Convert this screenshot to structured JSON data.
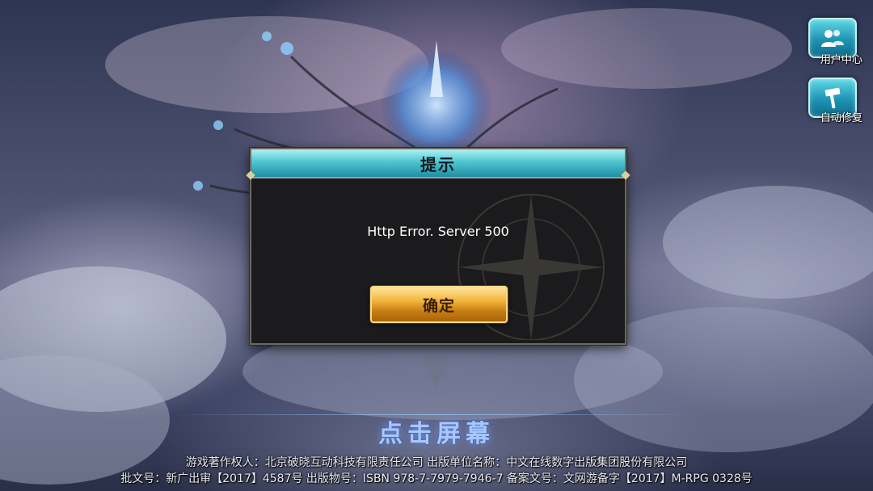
{
  "side_buttons": {
    "user_center": {
      "label": "用户中心",
      "icon": "users-icon"
    },
    "auto_repair": {
      "label": "自动修复",
      "icon": "hammer-icon"
    }
  },
  "dialog": {
    "title": "提示",
    "message": "Http Error. Server 500",
    "confirm_label": "确定"
  },
  "tap_prompt": "点击屏幕",
  "footer": {
    "line1": "游戏著作权人：北京破晓互动科技有限责任公司  出版单位名称：中文在线数字出版集团股份有限公司",
    "line2": "批文号：新广出审【2017】4587号  出版物号：ISBN 978-7-7979-7946-7  备案文号：文网游备字【2017】M-RPG 0328号"
  },
  "colors": {
    "header_accent": "#4fc6d1",
    "button_gold": "#f1b43c",
    "tap_prompt": "#a9c6ff"
  }
}
